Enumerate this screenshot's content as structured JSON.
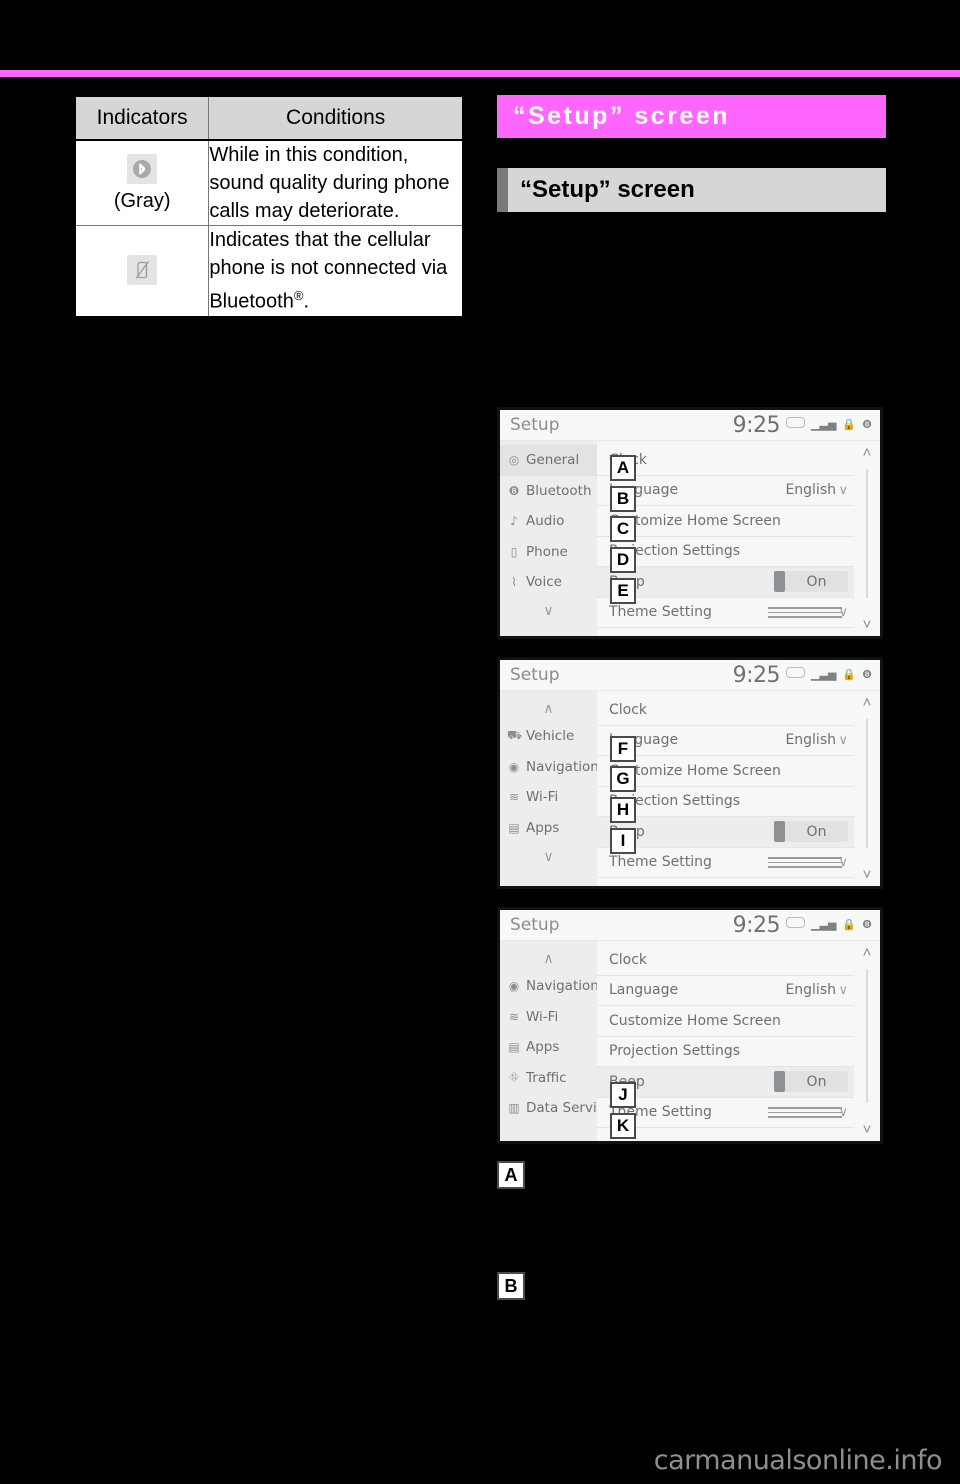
{
  "page": {
    "background": "#000000",
    "rule_color": "#ff66ff",
    "watermark": "carmanualsonline.info"
  },
  "indicator_table": {
    "headers": [
      "Indicators",
      "Conditions"
    ],
    "rows": [
      {
        "icon": "bluetooth-gray-icon",
        "icon_caption": "(Gray)",
        "condition": "While in this condition, sound quality during phone calls may deteriorate."
      },
      {
        "icon": "phone-disconnected-icon",
        "icon_caption": "",
        "condition_pre": "Indicates that the cellular phone is not connected via Bluetooth",
        "condition_sup": "®",
        "condition_post": "."
      }
    ]
  },
  "chapter_header": {
    "title": "“Setup” screen",
    "color": "#ff66ff"
  },
  "section_header": {
    "title": "“Setup” screen",
    "background": "#d6d6d6",
    "accent": "#7a7a7a"
  },
  "devices": [
    {
      "id": "device-1",
      "status": {
        "title": "Setup",
        "clock": "9:25",
        "icons": [
          "pill-icon",
          "signal-icon",
          "lock-icon",
          "bluetooth-icon"
        ]
      },
      "sidebar": {
        "items": [
          {
            "icon": "gear-icon",
            "label": "General",
            "selected": true
          },
          {
            "icon": "bluetooth-icon",
            "label": "Bluetooth",
            "selected": false
          },
          {
            "icon": "music-note-icon",
            "label": "Audio",
            "selected": false
          },
          {
            "icon": "phone-icon",
            "label": "Phone",
            "selected": false
          },
          {
            "icon": "voice-icon",
            "label": "Voice",
            "selected": false
          }
        ],
        "more_arrow": "∨"
      },
      "rows": [
        {
          "label": "Clock",
          "value": "",
          "chevron": "",
          "type": "plain"
        },
        {
          "label": "Language",
          "value": "English",
          "chevron": "∨",
          "type": "value"
        },
        {
          "label": "Customize Home Screen",
          "value": "",
          "chevron": "",
          "type": "plain"
        },
        {
          "label": "Projection Settings",
          "value": "",
          "chevron": "",
          "type": "plain"
        },
        {
          "label": "Beep",
          "value": "On",
          "chevron": "",
          "type": "toggle"
        },
        {
          "label": "Theme Setting",
          "value": "",
          "chevron": "∨",
          "type": "lines"
        }
      ],
      "scroll": {
        "up": "˄",
        "down": "˅"
      },
      "callouts": [
        {
          "letter": "A",
          "row": 0
        },
        {
          "letter": "B",
          "row": 1
        },
        {
          "letter": "C",
          "row": 2
        },
        {
          "letter": "D",
          "row": 3
        },
        {
          "letter": "E",
          "row": 4
        }
      ]
    },
    {
      "id": "device-2",
      "status": {
        "title": "Setup",
        "clock": "9:25",
        "icons": [
          "pill-icon",
          "signal-icon",
          "lock-icon",
          "bluetooth-icon"
        ]
      },
      "sidebar": {
        "up_arrow": "∧",
        "items": [
          {
            "icon": "vehicle-icon",
            "label": "Vehicle",
            "selected": false
          },
          {
            "icon": "navigation-icon",
            "label": "Navigation",
            "selected": false
          },
          {
            "icon": "wifi-icon",
            "label": "Wi-Fi",
            "selected": false
          },
          {
            "icon": "apps-icon",
            "label": "Apps",
            "selected": false
          }
        ],
        "more_arrow": "∨"
      },
      "rows": [
        {
          "label": "Clock",
          "value": "",
          "chevron": "",
          "type": "plain"
        },
        {
          "label": "Language",
          "value": "English",
          "chevron": "∨",
          "type": "value"
        },
        {
          "label": "Customize Home Screen",
          "value": "",
          "chevron": "",
          "type": "plain"
        },
        {
          "label": "Projection Settings",
          "value": "",
          "chevron": "",
          "type": "plain"
        },
        {
          "label": "Beep",
          "value": "On",
          "chevron": "",
          "type": "toggle"
        },
        {
          "label": "Theme Setting",
          "value": "",
          "chevron": "∨",
          "type": "lines"
        }
      ],
      "scroll": {
        "up": "˄",
        "down": "˅"
      },
      "callouts": [
        {
          "letter": "F",
          "row": 1
        },
        {
          "letter": "G",
          "row": 2
        },
        {
          "letter": "H",
          "row": 3
        },
        {
          "letter": "I",
          "row": 4
        }
      ]
    },
    {
      "id": "device-3",
      "status": {
        "title": "Setup",
        "clock": "9:25",
        "icons": [
          "pill-icon",
          "signal-icon",
          "lock-icon",
          "bluetooth-icon"
        ]
      },
      "sidebar": {
        "up_arrow": "∧",
        "items": [
          {
            "icon": "navigation-icon",
            "label": "Navigation",
            "selected": false
          },
          {
            "icon": "wifi-icon",
            "label": "Wi-Fi",
            "selected": false
          },
          {
            "icon": "apps-icon",
            "label": "Apps",
            "selected": false
          },
          {
            "icon": "traffic-icon",
            "label": "Traffic",
            "selected": false
          },
          {
            "icon": "data-services-icon",
            "label": "Data Services",
            "selected": false
          }
        ]
      },
      "rows": [
        {
          "label": "Clock",
          "value": "",
          "chevron": "",
          "type": "plain"
        },
        {
          "label": "Language",
          "value": "English",
          "chevron": "∨",
          "type": "value"
        },
        {
          "label": "Customize Home Screen",
          "value": "",
          "chevron": "",
          "type": "plain"
        },
        {
          "label": "Projection Settings",
          "value": "",
          "chevron": "",
          "type": "plain"
        },
        {
          "label": "Beep",
          "value": "On",
          "chevron": "",
          "type": "toggle"
        },
        {
          "label": "Theme Setting",
          "value": "",
          "chevron": "∨",
          "type": "lines"
        }
      ],
      "scroll": {
        "up": "˄",
        "down": "˅"
      },
      "callouts": [
        {
          "letter": "J",
          "row": 4
        },
        {
          "letter": "K",
          "row": 5
        }
      ]
    }
  ],
  "legend": [
    {
      "letter": "A",
      "text": ""
    },
    {
      "letter": "B",
      "text": ""
    }
  ]
}
